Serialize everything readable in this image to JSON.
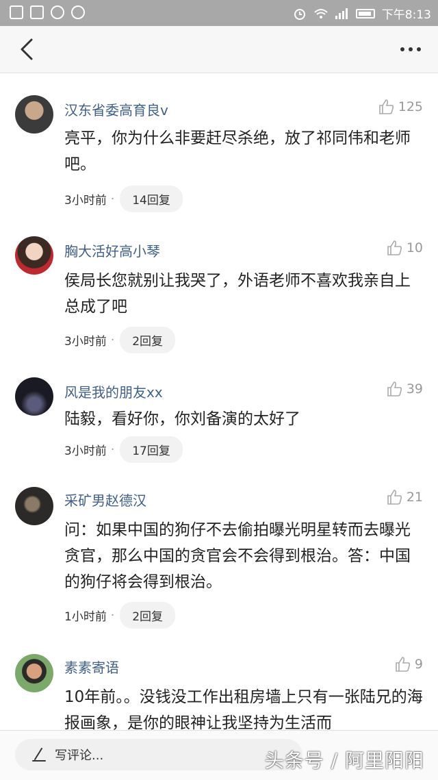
{
  "statusbar": {
    "time": "下午8:13"
  },
  "comments": [
    {
      "user": "汉东省委高育良v",
      "likes": "125",
      "text": "亮平，你为什么非要赶尽杀绝，放了祁同伟和老师吧。",
      "time": "3小时前",
      "dot": "·",
      "replies": "14回复"
    },
    {
      "user": "胸大活好高小琴",
      "likes": "10",
      "text": "侯局长您就别让我哭了，外语老师不喜欢我亲自上总成了吧",
      "time": "3小时前",
      "dot": "·",
      "replies": "2回复"
    },
    {
      "user": "风是我的朋友xx",
      "likes": "39",
      "text": "陆毅，看好你，你刘备演的太好了",
      "time": "3小时前",
      "dot": "·",
      "replies": "17回复"
    },
    {
      "user": "采矿男赵德汉",
      "likes": "21",
      "text": "问：如果中国的狗仔不去偷拍曝光明星转而去曝光贪官，那么中国的贪官会不会得到根治。答：中国的狗仔将会得到根治。",
      "time": "1小时前",
      "dot": "·",
      "replies": "2回复"
    },
    {
      "user": "素素寄语",
      "likes": "9",
      "text": "10年前。。没钱没工作出租房墙上只有一张陆兄的海报画象，是你的眼神让我坚持为生活而"
    }
  ],
  "bottombar": {
    "write_placeholder": "写评论...",
    "watermark": "头条号 / 阿里阳阳"
  }
}
